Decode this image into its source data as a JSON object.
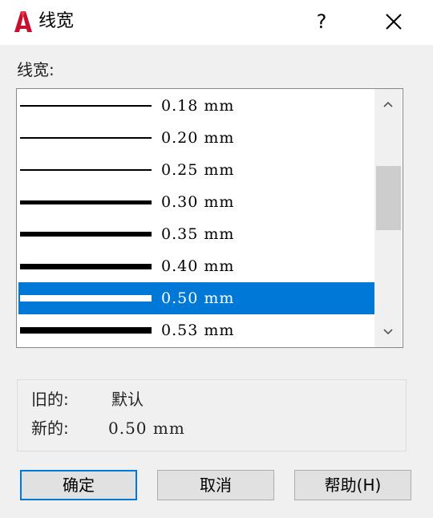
{
  "window": {
    "title": "线宽",
    "help_label": "?",
    "icon": "autocad-logo-icon",
    "close_icon": "close-icon"
  },
  "list": {
    "label": "线宽:",
    "items": [
      {
        "label": "0.18 mm",
        "weight": 0.18
      },
      {
        "label": "0.20 mm",
        "weight": 0.2
      },
      {
        "label": "0.25 mm",
        "weight": 0.25
      },
      {
        "label": "0.30 mm",
        "weight": 0.3
      },
      {
        "label": "0.35 mm",
        "weight": 0.35
      },
      {
        "label": "0.40 mm",
        "weight": 0.4
      },
      {
        "label": "0.50 mm",
        "weight": 0.5,
        "selected": true
      },
      {
        "label": "0.53 mm",
        "weight": 0.53
      }
    ],
    "selection_color": "#0078d7"
  },
  "info": {
    "old_label": "旧的:",
    "old_value": "默认",
    "new_label": "新的:",
    "new_value": "0.50 mm"
  },
  "buttons": {
    "ok": "确定",
    "cancel": "取消",
    "help": "帮助(H)"
  }
}
